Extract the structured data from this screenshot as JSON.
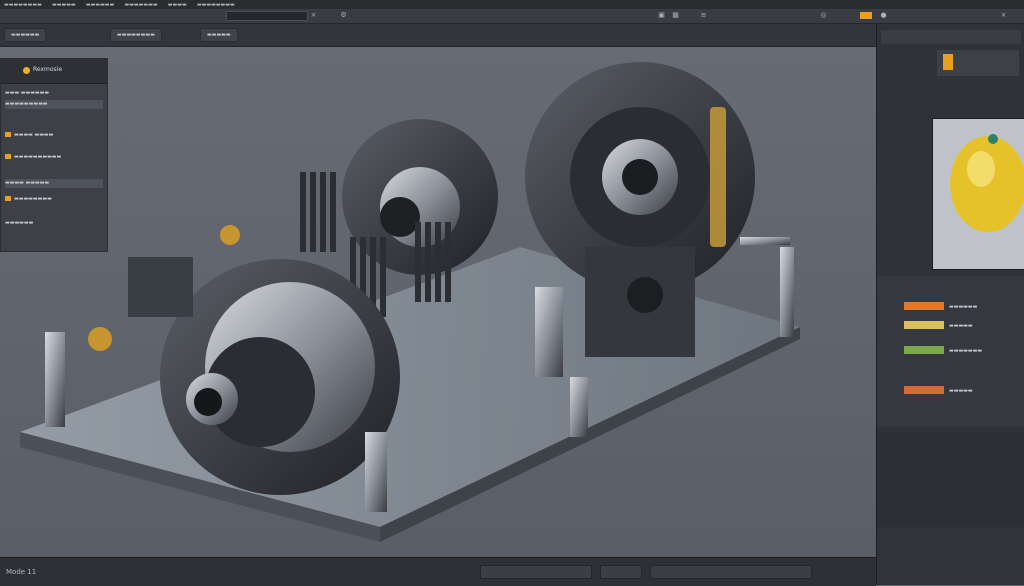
{
  "menubar": {
    "items": [
      "▬▬▬▬▬▬▬▬",
      "▬▬▬▬▬",
      "▬▬▬▬▬▬",
      "▬▬▬▬▬▬▬",
      "▬▬▬▬",
      "▬▬▬▬▬▬▬▬"
    ]
  },
  "toolbar": {
    "accent_color": "#e8a020"
  },
  "tabs": [
    "▬▬▬▬▬▬",
    "▬▬▬▬▬▬▬▬",
    "▬▬▬▬▬"
  ],
  "left_panel": {
    "app_name": "Rexmosie",
    "rows": [
      {
        "label": "▬▬▬ ▬▬▬▬▬▬",
        "chip": ""
      },
      {
        "label": "▬▬▬▬▬▬▬▬▬",
        "chip": ""
      },
      {
        "label": "▬▬▬▬ ▬▬▬▬",
        "chip": "#e8a020"
      },
      {
        "label": "▬▬▬▬▬▬▬▬▬▬",
        "chip": "#e8a020"
      },
      {
        "label": "▬▬▬▬ ▬▬▬▬▬",
        "chip": ""
      },
      {
        "label": "▬▬▬▬▬▬▬▬",
        "chip": "#e8a020"
      },
      {
        "label": "▬▬▬▬▬▬",
        "chip": ""
      }
    ]
  },
  "right_panel": {
    "list_colors": [
      "#e07a2a",
      "#d9c05a",
      "#7aa84a",
      "#d86a3a"
    ],
    "list_text": [
      "▬▬▬▬▬▬",
      "▬▬▬▬▬",
      "▬▬▬▬▬▬▬",
      "▬▬▬▬▬"
    ]
  },
  "statusbar": {
    "text": "Mode 11"
  }
}
